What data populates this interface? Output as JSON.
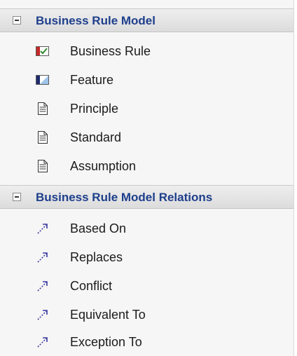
{
  "groups": [
    {
      "title": "Business Rule Model",
      "items": [
        {
          "label": "Business Rule",
          "icon": "business-rule-icon"
        },
        {
          "label": "Feature",
          "icon": "feature-icon"
        },
        {
          "label": "Principle",
          "icon": "document-icon"
        },
        {
          "label": "Standard",
          "icon": "document-icon"
        },
        {
          "label": "Assumption",
          "icon": "document-icon"
        }
      ]
    },
    {
      "title": "Business Rule Model Relations",
      "items": [
        {
          "label": "Based On",
          "icon": "dashed-arrow-icon"
        },
        {
          "label": "Replaces",
          "icon": "dashed-arrow-icon"
        },
        {
          "label": "Conflict",
          "icon": "dashed-arrow-icon"
        },
        {
          "label": "Equivalent To",
          "icon": "dashed-arrow-icon"
        },
        {
          "label": "Exception To",
          "icon": "dashed-arrow-icon"
        }
      ]
    }
  ],
  "colors": {
    "header_text": "#1e3f8c",
    "panel_bg": "#f6f6f6",
    "relation_icon": "#3a3aa0"
  }
}
